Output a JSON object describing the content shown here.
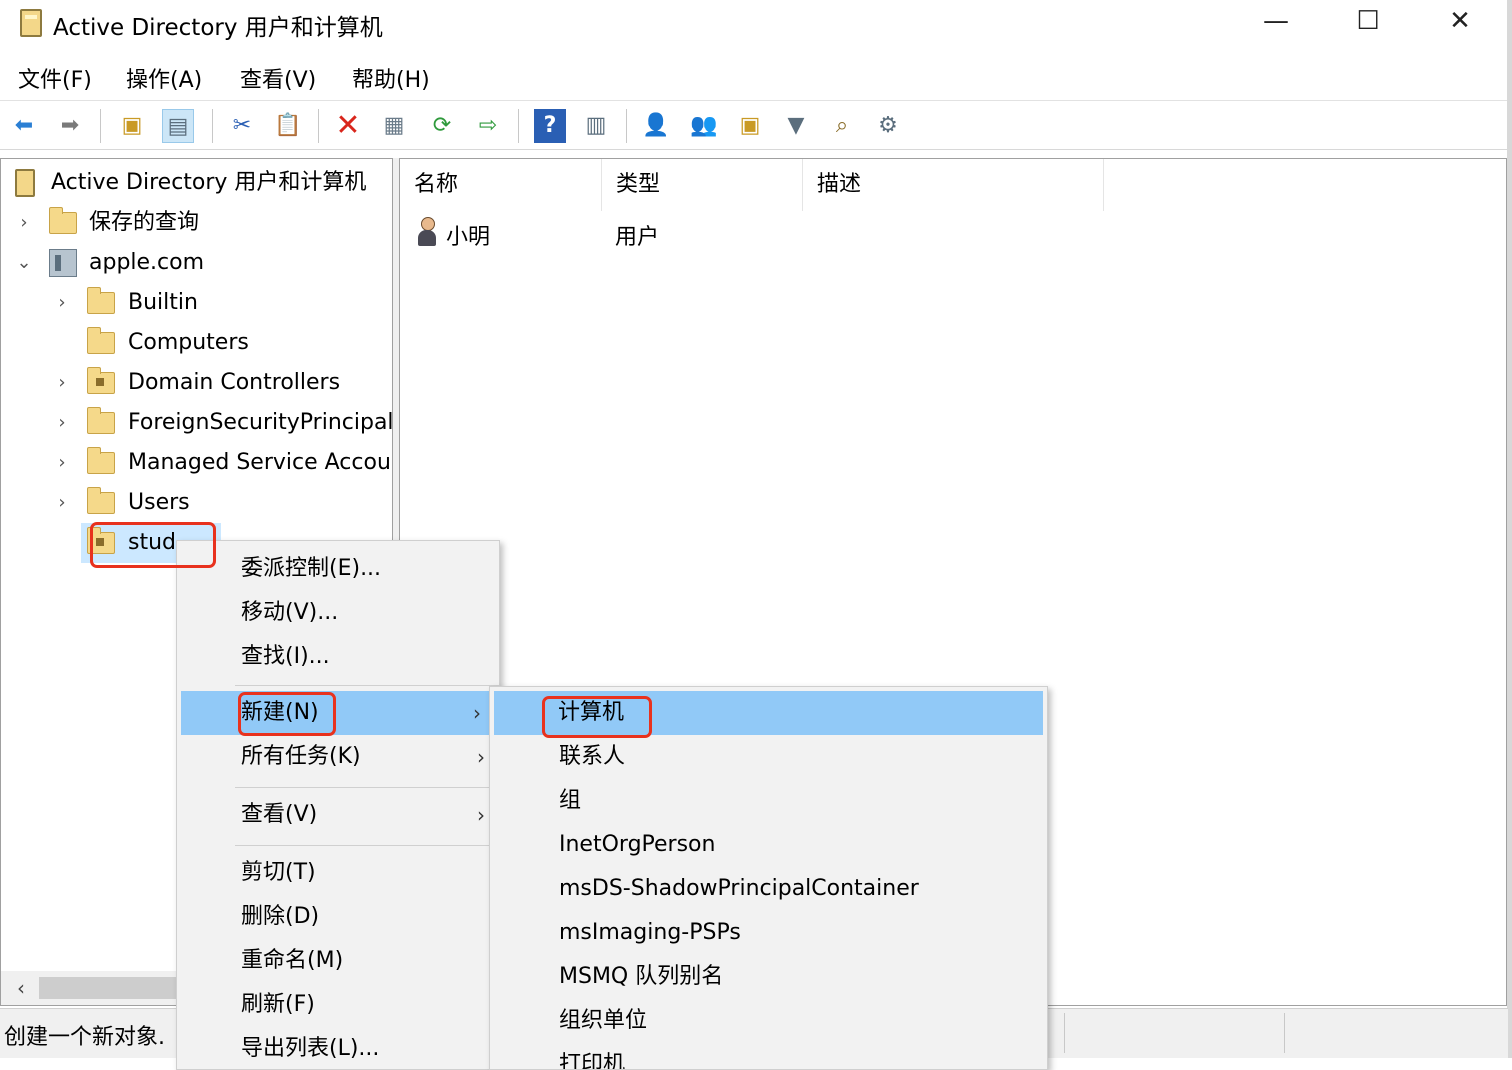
{
  "window": {
    "title": "Active Directory 用户和计算机",
    "controls": {
      "minimize": "—",
      "maximize": "☐",
      "close": "✕"
    }
  },
  "menubar": [
    "文件(F)",
    "操作(A)",
    "查看(V)",
    "帮助(H)"
  ],
  "toolbar": {
    "icons": [
      "back-arrow-icon",
      "forward-arrow-icon",
      "up-folder-icon",
      "show-console-tree-icon",
      "cut-icon",
      "paste-icon",
      "delete-icon",
      "properties-icon",
      "refresh-icon",
      "export-list-icon",
      "help-icon",
      "details-view-icon",
      "new-user-icon",
      "new-group-icon",
      "new-ou-icon",
      "filter-icon",
      "find-icon",
      "delegate-icon"
    ],
    "colors": {
      "back": "#2a7fd4",
      "delete": "#d9261c",
      "help": "#2a5fb4"
    }
  },
  "tree": {
    "root": "Active Directory 用户和计算机",
    "saved_queries": "保存的查询",
    "domain": "apple.com",
    "children": [
      "Builtin",
      "Computers",
      "Domain Controllers",
      "ForeignSecurityPrincipals",
      "Managed Service Accounts",
      "Users"
    ],
    "selected_ou": "stud"
  },
  "list": {
    "headers": {
      "name": "名称",
      "type": "类型",
      "description": "描述"
    },
    "rows": [
      {
        "name": "小明",
        "type": "用户",
        "description": ""
      }
    ]
  },
  "status": {
    "text": "创建一个新对象."
  },
  "context_menu": {
    "items": [
      "委派控制(E)...",
      "移动(V)...",
      "查找(I)...",
      "新建(N)",
      "所有任务(K)",
      "查看(V)",
      "剪切(T)",
      "删除(D)",
      "重命名(M)",
      "刷新(F)",
      "导出列表(L)..."
    ],
    "submenu_arrow": "›"
  },
  "submenu": {
    "items": [
      "计算机",
      "联系人",
      "组",
      "InetOrgPerson",
      "msDS-ShadowPrincipalContainer",
      "msImaging-PSPs",
      "MSMQ 队列别名",
      "组织单位",
      "打印机"
    ]
  },
  "highlight_color": "#e8321e"
}
